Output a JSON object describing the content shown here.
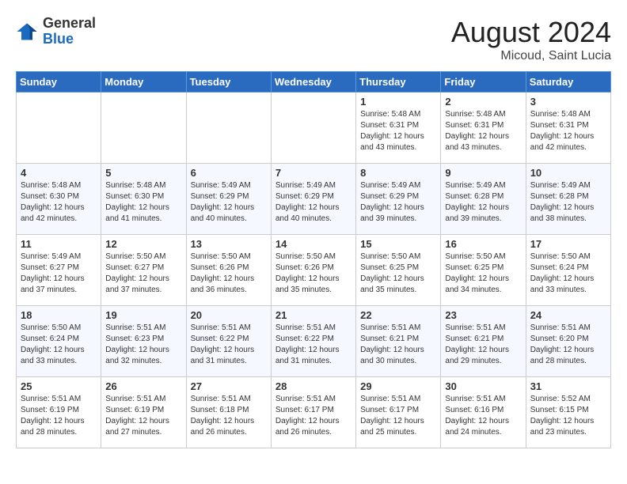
{
  "logo": {
    "general": "General",
    "blue": "Blue"
  },
  "title": {
    "month_year": "August 2024",
    "location": "Micoud, Saint Lucia"
  },
  "weekdays": [
    "Sunday",
    "Monday",
    "Tuesday",
    "Wednesday",
    "Thursday",
    "Friday",
    "Saturday"
  ],
  "weeks": [
    [
      {
        "day": "",
        "info": ""
      },
      {
        "day": "",
        "info": ""
      },
      {
        "day": "",
        "info": ""
      },
      {
        "day": "",
        "info": ""
      },
      {
        "day": "1",
        "info": "Sunrise: 5:48 AM\nSunset: 6:31 PM\nDaylight: 12 hours\nand 43 minutes."
      },
      {
        "day": "2",
        "info": "Sunrise: 5:48 AM\nSunset: 6:31 PM\nDaylight: 12 hours\nand 43 minutes."
      },
      {
        "day": "3",
        "info": "Sunrise: 5:48 AM\nSunset: 6:31 PM\nDaylight: 12 hours\nand 42 minutes."
      }
    ],
    [
      {
        "day": "4",
        "info": "Sunrise: 5:48 AM\nSunset: 6:30 PM\nDaylight: 12 hours\nand 42 minutes."
      },
      {
        "day": "5",
        "info": "Sunrise: 5:48 AM\nSunset: 6:30 PM\nDaylight: 12 hours\nand 41 minutes."
      },
      {
        "day": "6",
        "info": "Sunrise: 5:49 AM\nSunset: 6:29 PM\nDaylight: 12 hours\nand 40 minutes."
      },
      {
        "day": "7",
        "info": "Sunrise: 5:49 AM\nSunset: 6:29 PM\nDaylight: 12 hours\nand 40 minutes."
      },
      {
        "day": "8",
        "info": "Sunrise: 5:49 AM\nSunset: 6:29 PM\nDaylight: 12 hours\nand 39 minutes."
      },
      {
        "day": "9",
        "info": "Sunrise: 5:49 AM\nSunset: 6:28 PM\nDaylight: 12 hours\nand 39 minutes."
      },
      {
        "day": "10",
        "info": "Sunrise: 5:49 AM\nSunset: 6:28 PM\nDaylight: 12 hours\nand 38 minutes."
      }
    ],
    [
      {
        "day": "11",
        "info": "Sunrise: 5:49 AM\nSunset: 6:27 PM\nDaylight: 12 hours\nand 37 minutes."
      },
      {
        "day": "12",
        "info": "Sunrise: 5:50 AM\nSunset: 6:27 PM\nDaylight: 12 hours\nand 37 minutes."
      },
      {
        "day": "13",
        "info": "Sunrise: 5:50 AM\nSunset: 6:26 PM\nDaylight: 12 hours\nand 36 minutes."
      },
      {
        "day": "14",
        "info": "Sunrise: 5:50 AM\nSunset: 6:26 PM\nDaylight: 12 hours\nand 35 minutes."
      },
      {
        "day": "15",
        "info": "Sunrise: 5:50 AM\nSunset: 6:25 PM\nDaylight: 12 hours\nand 35 minutes."
      },
      {
        "day": "16",
        "info": "Sunrise: 5:50 AM\nSunset: 6:25 PM\nDaylight: 12 hours\nand 34 minutes."
      },
      {
        "day": "17",
        "info": "Sunrise: 5:50 AM\nSunset: 6:24 PM\nDaylight: 12 hours\nand 33 minutes."
      }
    ],
    [
      {
        "day": "18",
        "info": "Sunrise: 5:50 AM\nSunset: 6:24 PM\nDaylight: 12 hours\nand 33 minutes."
      },
      {
        "day": "19",
        "info": "Sunrise: 5:51 AM\nSunset: 6:23 PM\nDaylight: 12 hours\nand 32 minutes."
      },
      {
        "day": "20",
        "info": "Sunrise: 5:51 AM\nSunset: 6:22 PM\nDaylight: 12 hours\nand 31 minutes."
      },
      {
        "day": "21",
        "info": "Sunrise: 5:51 AM\nSunset: 6:22 PM\nDaylight: 12 hours\nand 31 minutes."
      },
      {
        "day": "22",
        "info": "Sunrise: 5:51 AM\nSunset: 6:21 PM\nDaylight: 12 hours\nand 30 minutes."
      },
      {
        "day": "23",
        "info": "Sunrise: 5:51 AM\nSunset: 6:21 PM\nDaylight: 12 hours\nand 29 minutes."
      },
      {
        "day": "24",
        "info": "Sunrise: 5:51 AM\nSunset: 6:20 PM\nDaylight: 12 hours\nand 28 minutes."
      }
    ],
    [
      {
        "day": "25",
        "info": "Sunrise: 5:51 AM\nSunset: 6:19 PM\nDaylight: 12 hours\nand 28 minutes."
      },
      {
        "day": "26",
        "info": "Sunrise: 5:51 AM\nSunset: 6:19 PM\nDaylight: 12 hours\nand 27 minutes."
      },
      {
        "day": "27",
        "info": "Sunrise: 5:51 AM\nSunset: 6:18 PM\nDaylight: 12 hours\nand 26 minutes."
      },
      {
        "day": "28",
        "info": "Sunrise: 5:51 AM\nSunset: 6:17 PM\nDaylight: 12 hours\nand 26 minutes."
      },
      {
        "day": "29",
        "info": "Sunrise: 5:51 AM\nSunset: 6:17 PM\nDaylight: 12 hours\nand 25 minutes."
      },
      {
        "day": "30",
        "info": "Sunrise: 5:51 AM\nSunset: 6:16 PM\nDaylight: 12 hours\nand 24 minutes."
      },
      {
        "day": "31",
        "info": "Sunrise: 5:52 AM\nSunset: 6:15 PM\nDaylight: 12 hours\nand 23 minutes."
      }
    ]
  ]
}
